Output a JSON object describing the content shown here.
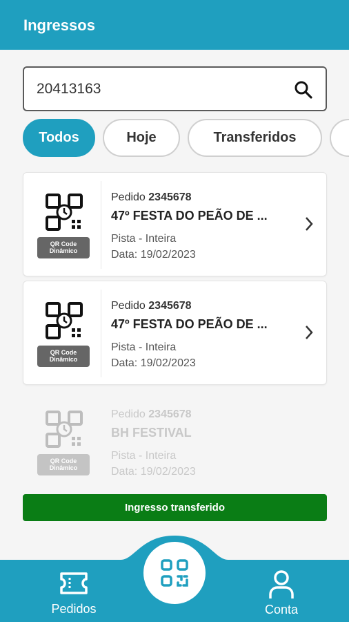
{
  "header": {
    "title": "Ingressos"
  },
  "search": {
    "value": "20413163"
  },
  "filters": [
    {
      "label": "Todos"
    },
    {
      "label": "Hoje"
    },
    {
      "label": "Transferidos"
    }
  ],
  "tickets": [
    {
      "order_label": "Pedido",
      "order_number": "2345678",
      "event": "47º FESTA DO PEÃO DE ...",
      "sector": "Pista - Inteira",
      "date": "Data: 19/02/2023",
      "qr_badge_line1": "QR Code",
      "qr_badge_line2": "Dinâmico"
    },
    {
      "order_label": "Pedido",
      "order_number": "2345678",
      "event": "47º FESTA DO PEÃO DE ...",
      "sector": "Pista - Inteira",
      "date": "Data: 19/02/2023",
      "qr_badge_line1": "QR Code",
      "qr_badge_line2": "Dinâmico"
    },
    {
      "order_label": "Pedido",
      "order_number": "2345678",
      "event": "BH FESTIVAL",
      "sector": "Pista - Inteira",
      "date": "Data: 19/02/2023",
      "qr_badge_line1": "QR Code",
      "qr_badge_line2": "Dinâmico",
      "status": "Ingresso transferido"
    }
  ],
  "bottom_nav": {
    "left_label": "Pedidos",
    "right_label": "Conta"
  },
  "colors": {
    "primary": "#1f9fbf",
    "transferred": "#0a7d15"
  }
}
